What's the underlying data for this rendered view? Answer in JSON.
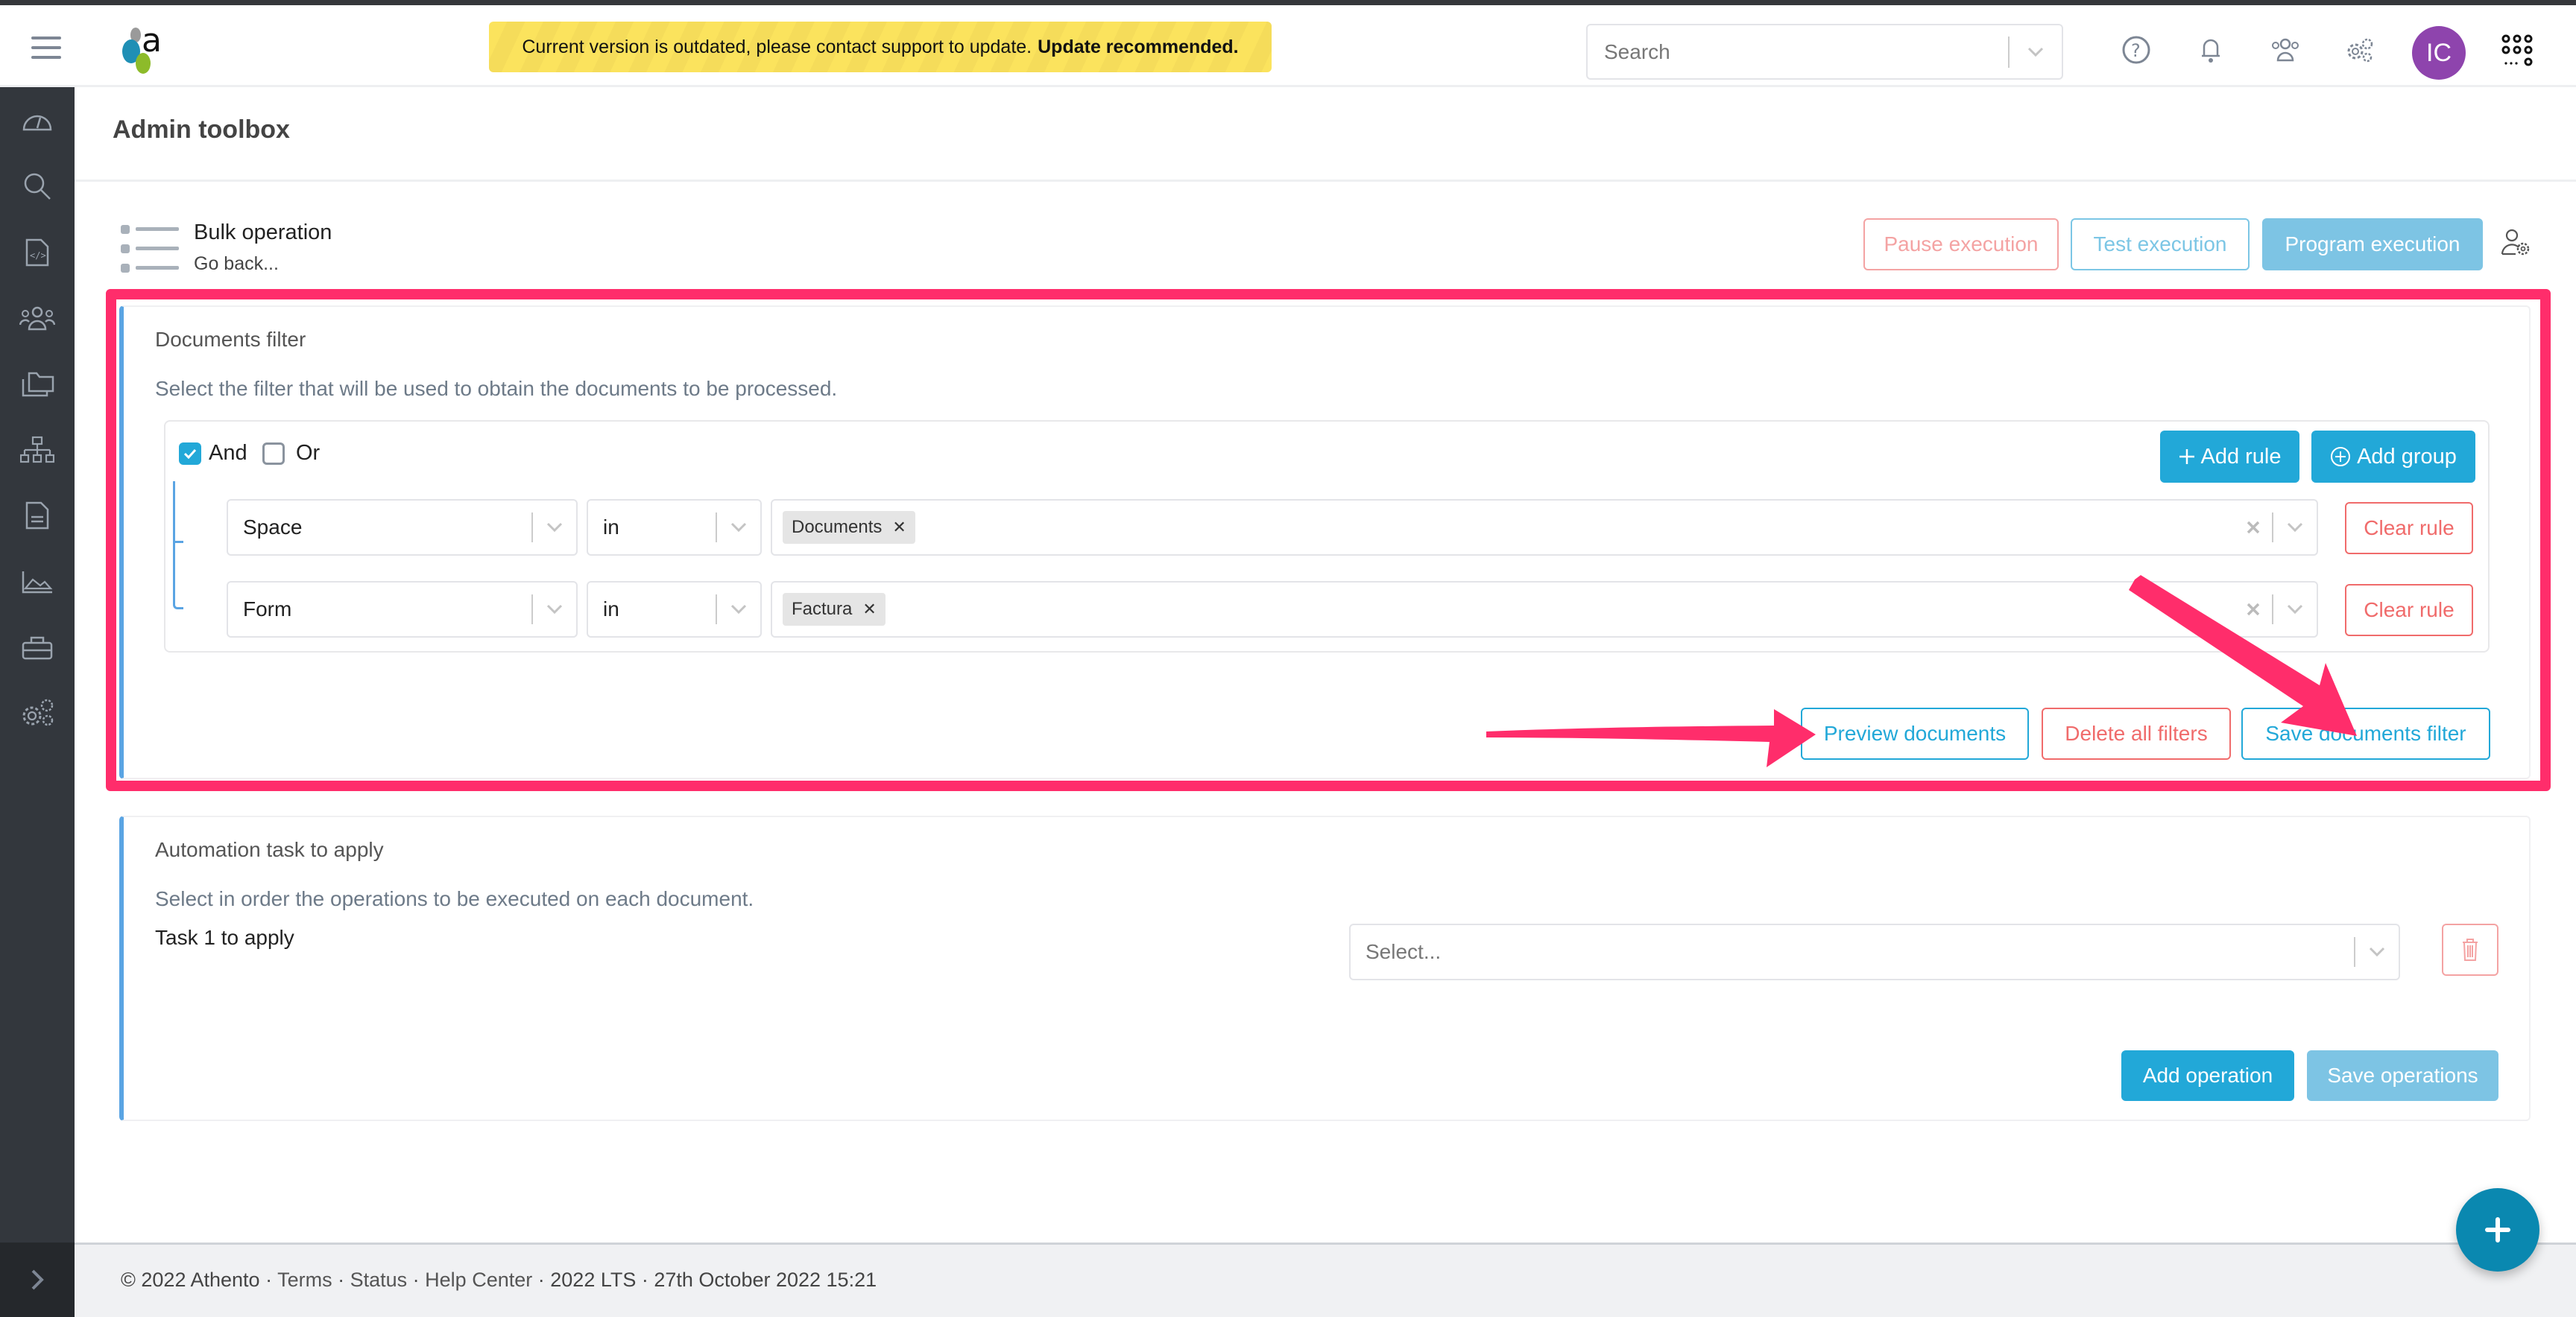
{
  "header": {
    "banner_text": "Current version is outdated, please contact support to update.",
    "banner_bold": "Update recommended.",
    "search_placeholder": "Search",
    "avatar_initials": "IC",
    "icons": [
      "help-icon",
      "bell-icon",
      "users-icon",
      "settings-icon",
      "apps-grid-icon"
    ]
  },
  "sidebar": {
    "items": [
      {
        "name": "dashboard",
        "icon": "gauge-icon"
      },
      {
        "name": "search",
        "icon": "search-icon"
      },
      {
        "name": "code-document",
        "icon": "code-file-icon"
      },
      {
        "name": "teams",
        "icon": "group-icon"
      },
      {
        "name": "folders",
        "icon": "folders-icon"
      },
      {
        "name": "hierarchy",
        "icon": "sitemap-icon"
      },
      {
        "name": "documents",
        "icon": "document-icon"
      },
      {
        "name": "reports",
        "icon": "area-chart-icon"
      },
      {
        "name": "toolbox",
        "icon": "toolbox-icon"
      },
      {
        "name": "settings",
        "icon": "gears-icon"
      }
    ],
    "expand_icon": "chevron-right-icon"
  },
  "page": {
    "title": "Admin toolbox",
    "bulk_title": "Bulk operation",
    "go_back": "Go back...",
    "actions": {
      "pause": "Pause execution",
      "test": "Test execution",
      "program": "Program execution"
    }
  },
  "filter": {
    "title": "Documents filter",
    "description": "Select the filter that will be used to obtain the documents to be processed.",
    "conjunction": {
      "and_label": "And",
      "and_checked": true,
      "or_label": "Or",
      "or_checked": false
    },
    "add_rule": "Add rule",
    "add_group": "Add group",
    "rules": [
      {
        "field": "Space",
        "operator": "in",
        "values": [
          "Documents"
        ],
        "clear_label": "Clear rule"
      },
      {
        "field": "Form",
        "operator": "in",
        "values": [
          "Factura"
        ],
        "clear_label": "Clear rule"
      }
    ],
    "preview": "Preview documents",
    "delete_all": "Delete all filters",
    "save": "Save documents filter"
  },
  "automation": {
    "title": "Automation task to apply",
    "description": "Select in order the operations to be executed on each document.",
    "task_label": "Task 1 to apply",
    "task_placeholder": "Select...",
    "add_operation": "Add operation",
    "save_operations": "Save operations"
  },
  "footer": {
    "copyright": "© 2022 Athento",
    "links": [
      "Terms",
      "Status",
      "Help Center"
    ],
    "version": "2022 LTS",
    "date": "27th October 2022 15:21"
  },
  "colors": {
    "accent_blue": "#22a8d8",
    "danger_red": "#f06b6b",
    "annotation_pink": "#ff2d6b",
    "sidebar_bg": "#33373d",
    "avatar_purple": "#8e44ad",
    "fab_teal": "#0a88b0"
  }
}
